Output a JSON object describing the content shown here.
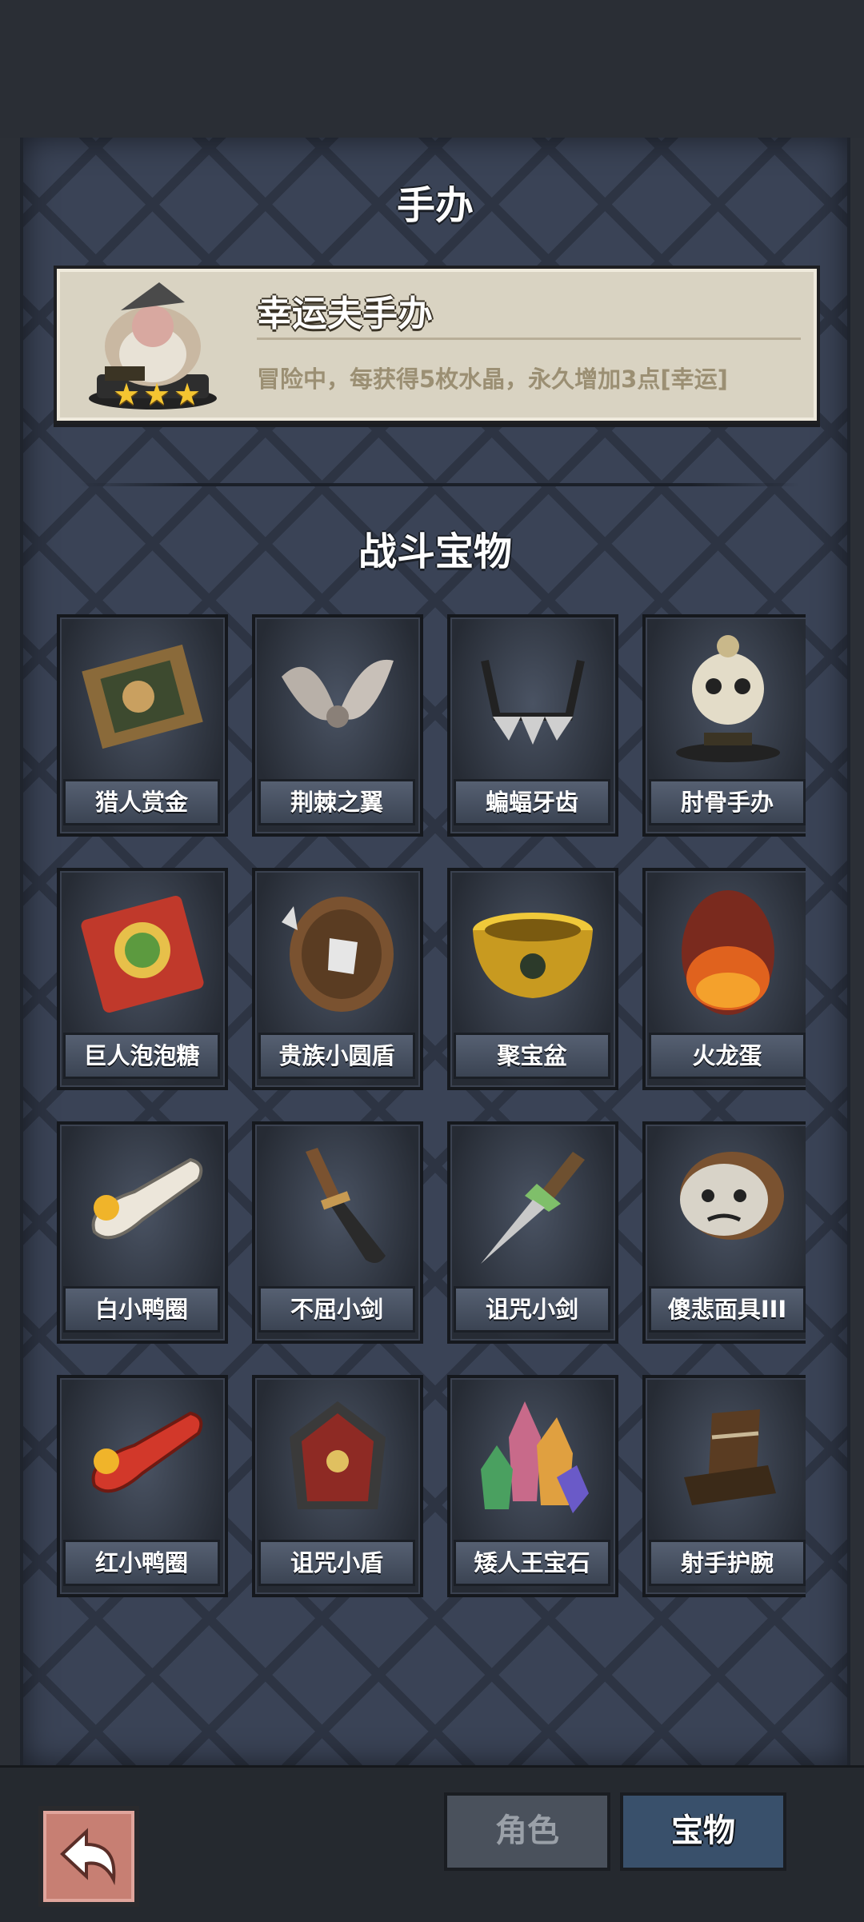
{
  "sections": {
    "figure_title": "手办",
    "battle_title": "战斗宝物"
  },
  "figure": {
    "name": "幸运夫手办",
    "description": "冒险中，每获得5枚水晶，永久增加3点[幸运]",
    "stars": 3,
    "icon": "dwarf-figurine-icon"
  },
  "treasures": [
    {
      "label": "猎人赏金",
      "icon": "wanted-poster-icon"
    },
    {
      "label": "荆棘之翼",
      "icon": "thorn-wings-icon"
    },
    {
      "label": "蝙蝠牙齿",
      "icon": "bat-teeth-icon"
    },
    {
      "label": "肘骨手办",
      "icon": "skull-figurine-icon"
    },
    {
      "label": "巨人泡泡糖",
      "icon": "bubble-gum-pack-icon"
    },
    {
      "label": "贵族小圆盾",
      "icon": "round-shield-icon"
    },
    {
      "label": "聚宝盆",
      "icon": "golden-bowl-icon"
    },
    {
      "label": "火龙蛋",
      "icon": "dragon-egg-icon"
    },
    {
      "label": "白小鸭圈",
      "icon": "white-duck-ring-icon"
    },
    {
      "label": "不屈小剑",
      "icon": "short-sword-icon"
    },
    {
      "label": "诅咒小剑",
      "icon": "cursed-dagger-icon"
    },
    {
      "label": "傻悲面具III",
      "icon": "sad-mask-icon"
    },
    {
      "label": "红小鸭圈",
      "icon": "red-duck-ring-icon"
    },
    {
      "label": "诅咒小盾",
      "icon": "cursed-shield-icon"
    },
    {
      "label": "矮人王宝石",
      "icon": "gem-cluster-icon"
    },
    {
      "label": "射手护腕",
      "icon": "archer-bracer-icon"
    },
    {
      "label": "",
      "icon": "potion-bottle-icon"
    },
    {
      "label": "",
      "icon": "flower-branch-icon"
    },
    {
      "label": "",
      "icon": "twin-blades-icon"
    },
    {
      "label": "",
      "icon": "toad-creature-icon"
    }
  ],
  "bottom": {
    "back_icon": "back-arrow-icon",
    "tab_role": "角色",
    "tab_treasure": "宝物",
    "active_tab": "宝物"
  },
  "colors": {
    "panel": "#3a4356",
    "card": "#d9d3c2",
    "active_tab": "#39506b",
    "star": "#f4c531"
  }
}
